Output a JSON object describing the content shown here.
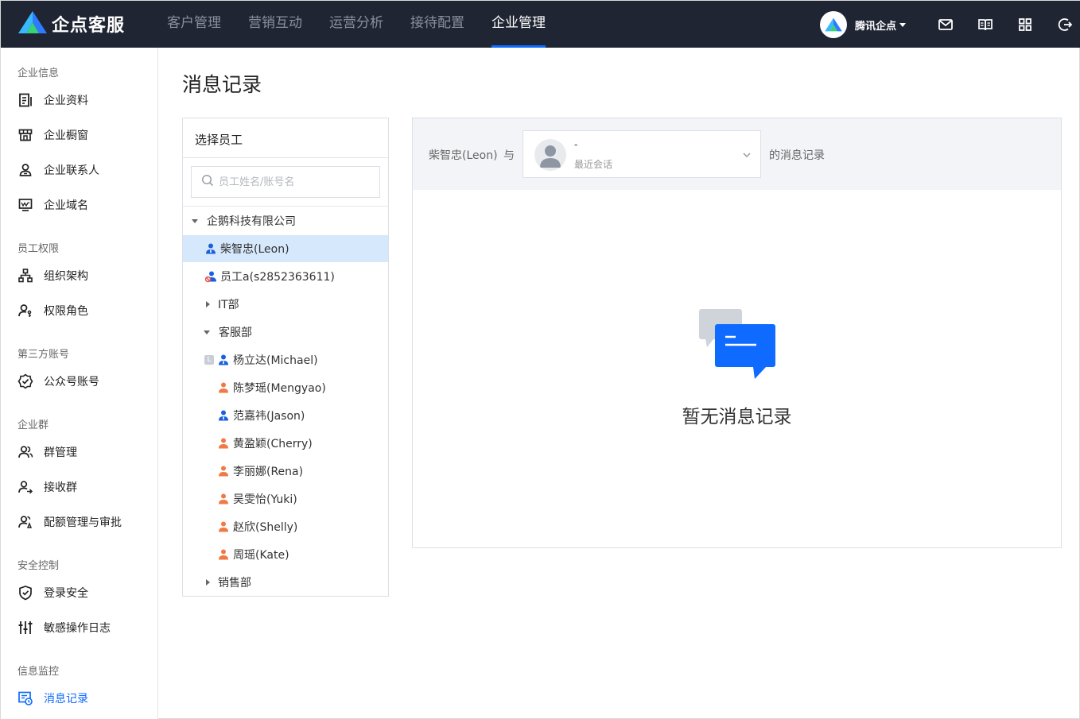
{
  "app": {
    "name": "企点客服",
    "brand_color": "#0f6bff",
    "topbar_color": "#1f2533"
  },
  "nav": {
    "items": [
      {
        "label": "客户管理",
        "active": false
      },
      {
        "label": "营销互动",
        "active": false
      },
      {
        "label": "运营分析",
        "active": false
      },
      {
        "label": "接待配置",
        "active": false
      },
      {
        "label": "企业管理",
        "active": true
      }
    ]
  },
  "account": {
    "name": "腾讯企点"
  },
  "top_icons": [
    "mail-icon",
    "book-icon",
    "apps-grid-icon",
    "logout-icon"
  ],
  "sidebar": {
    "groups": [
      {
        "title": "企业信息",
        "items": [
          {
            "label": "企业资料",
            "icon": "document-icon"
          },
          {
            "label": "企业橱窗",
            "icon": "storefront-icon"
          },
          {
            "label": "企业联系人",
            "icon": "contact-person-icon"
          },
          {
            "label": "企业域名",
            "icon": "domain-monitor-icon"
          }
        ]
      },
      {
        "title": "员工权限",
        "items": [
          {
            "label": "组织架构",
            "icon": "org-structure-icon"
          },
          {
            "label": "权限角色",
            "icon": "role-icon"
          }
        ]
      },
      {
        "title": "第三方账号",
        "items": [
          {
            "label": "公众号账号",
            "icon": "official-account-icon"
          }
        ]
      },
      {
        "title": "企业群",
        "items": [
          {
            "label": "群管理",
            "icon": "group-icon"
          },
          {
            "label": "接收群",
            "icon": "receive-group-icon"
          },
          {
            "label": "配额管理与审批",
            "icon": "quota-icon"
          }
        ]
      },
      {
        "title": "安全控制",
        "items": [
          {
            "label": "登录安全",
            "icon": "shield-check-icon"
          },
          {
            "label": "敏感操作日志",
            "icon": "sliders-icon"
          }
        ]
      },
      {
        "title": "信息监控",
        "items": [
          {
            "label": "消息记录",
            "icon": "message-record-icon",
            "active": true
          }
        ]
      }
    ]
  },
  "page": {
    "title": "消息记录"
  },
  "employee_panel": {
    "title": "选择员工",
    "search_placeholder": "员工姓名/账号名",
    "tree": [
      {
        "label": "企鹅科技有限公司",
        "type": "org",
        "expanded": true,
        "level": 0
      },
      {
        "label": "柴智忠(Leon)",
        "type": "person-blue",
        "level": 1,
        "selected": true
      },
      {
        "label": "员工a(s2852363611)",
        "type": "person-disabled",
        "level": 1
      },
      {
        "label": "IT部",
        "type": "dept",
        "expanded": false,
        "level": 1
      },
      {
        "label": "客服部",
        "type": "dept",
        "expanded": true,
        "level": 1
      },
      {
        "label": "杨立达(Michael)",
        "type": "person-blue-leader",
        "level": 2
      },
      {
        "label": "陈梦瑶(Mengyao)",
        "type": "person-orange",
        "level": 2
      },
      {
        "label": "范嘉祎(Jason)",
        "type": "person-blue",
        "level": 2
      },
      {
        "label": "黄盈颖(Cherry)",
        "type": "person-orange",
        "level": 2
      },
      {
        "label": "李丽娜(Rena)",
        "type": "person-orange",
        "level": 2
      },
      {
        "label": "吴雯怡(Yuki)",
        "type": "person-orange",
        "level": 2
      },
      {
        "label": "赵欣(Shelly)",
        "type": "person-orange",
        "level": 2
      },
      {
        "label": "周瑶(Kate)",
        "type": "person-orange",
        "level": 2
      },
      {
        "label": "销售部",
        "type": "dept",
        "expanded": false,
        "level": 1
      }
    ],
    "leader_badge": "L"
  },
  "chat_panel": {
    "employee": "柴智忠(Leon)",
    "with_label": "与",
    "select_name": "-",
    "select_sub": "最近会话",
    "suffix": "的消息记录",
    "empty_text": "暂无消息记录"
  }
}
